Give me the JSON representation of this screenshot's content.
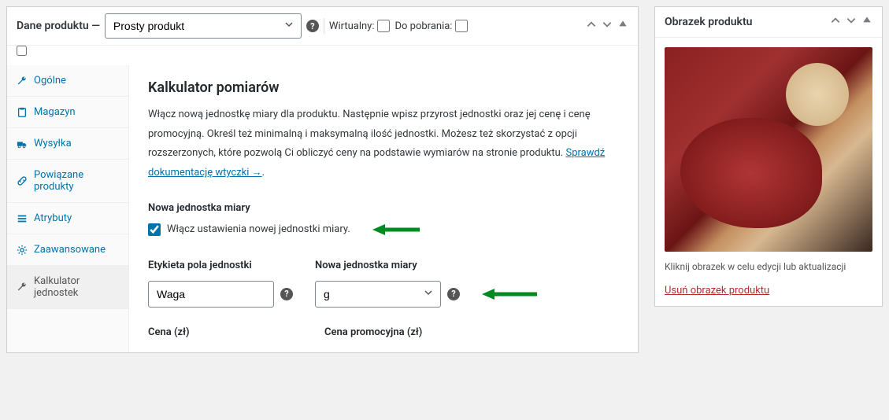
{
  "header": {
    "title": "Dane produktu —",
    "product_type": "Prosty produkt",
    "virtual_label": "Wirtualny:",
    "downloadable_label": "Do pobrania:"
  },
  "tabs": [
    {
      "label": "Ogólne",
      "icon": "wrench"
    },
    {
      "label": "Magazyn",
      "icon": "clipboard"
    },
    {
      "label": "Wysyłka",
      "icon": "truck"
    },
    {
      "label": "Powiązane produkty",
      "icon": "link"
    },
    {
      "label": "Atrybuty",
      "icon": "list"
    },
    {
      "label": "Zaawansowane",
      "icon": "gear"
    },
    {
      "label": "Kalkulator jednostek",
      "icon": "wrench"
    }
  ],
  "content": {
    "heading": "Kalkulator pomiarów",
    "description_before": "Włącz nową jednostkę miary dla produktu. Następnie wpisz przyrost jednostki oraz jej cenę i cenę promocyjną. Określ też minimalną i maksymalną ilość jednostki. Możesz też skorzystać z opcji rozszerzonych, które pozwolą Ci obliczyć ceny na podstawie wymiarów na stronie produktu. ",
    "doc_link": "Sprawdź dokumentację wtyczki →",
    "section_new_unit": "Nowa jednostka miary",
    "enable_checkbox": "Włącz ustawienia nowej jednostki miary.",
    "field1_label": "Etykieta pola jednostki",
    "field1_value": "Waga",
    "field2_label": "Nowa jednostka miary",
    "field2_value": "g",
    "price_label": "Cena (zł)",
    "promo_price_label": "Cena promocyjna (zł)"
  },
  "sidebar": {
    "title": "Obrazek produktu",
    "caption": "Kliknij obrazek w celu edycji lub aktualizacji",
    "remove_link": "Usuń obrazek produktu"
  }
}
